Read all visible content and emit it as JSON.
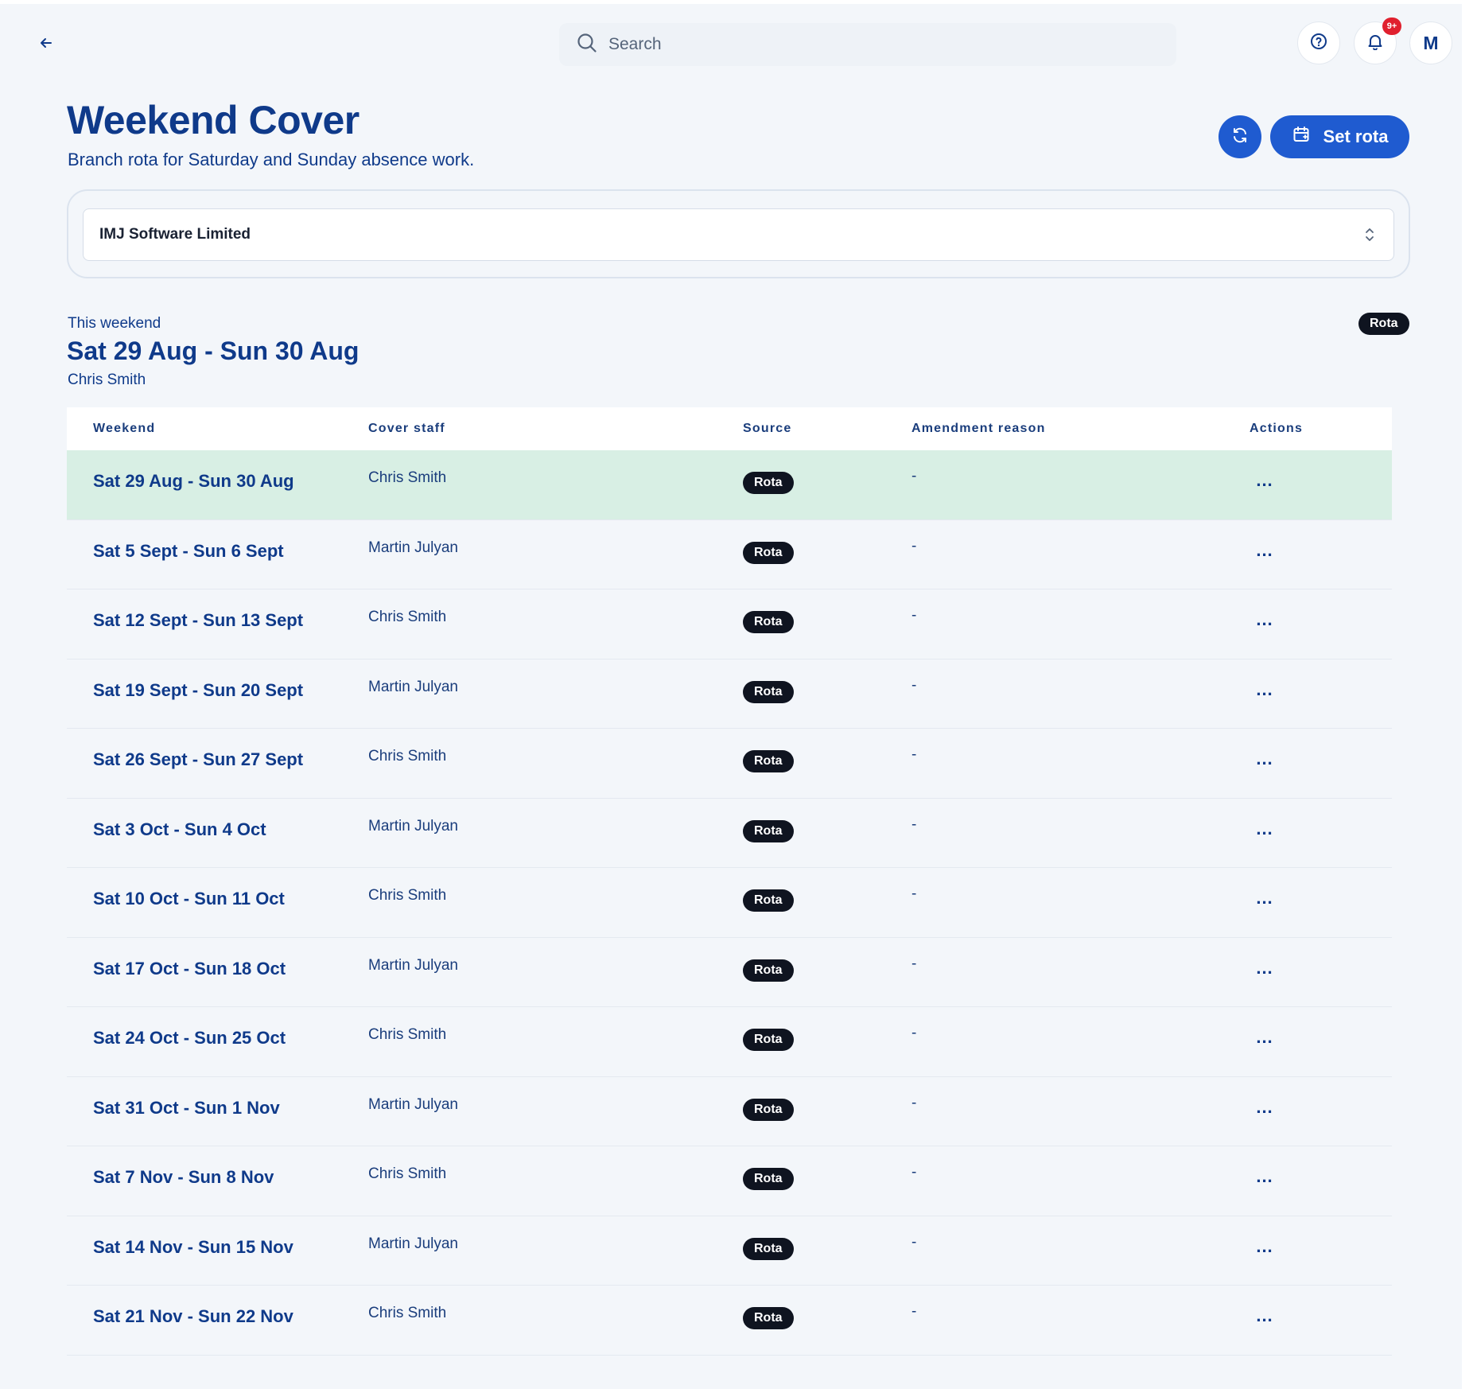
{
  "topbar": {
    "search_placeholder": "Search",
    "notification_count": "9+",
    "avatar_initial": "M"
  },
  "header": {
    "title": "Weekend Cover",
    "subtitle": "Branch rota for Saturday and Sunday absence work.",
    "set_rota_label": "Set rota"
  },
  "branch_select": {
    "value": "IMJ Software Limited"
  },
  "this_weekend": {
    "label": "This weekend",
    "dates": "Sat 29 Aug - Sun 30 Aug",
    "staff": "Chris Smith",
    "source": "Rota"
  },
  "table": {
    "columns": [
      "Weekend",
      "Cover staff",
      "Source",
      "Amendment reason",
      "Actions"
    ],
    "rows": [
      {
        "weekend": "Sat 29 Aug - Sun 30 Aug",
        "staff": "Chris Smith",
        "source": "Rota",
        "reason": "-",
        "actions": "...",
        "current": true
      },
      {
        "weekend": "Sat 5 Sept - Sun 6 Sept",
        "staff": "Martin Julyan",
        "source": "Rota",
        "reason": "-",
        "actions": "..."
      },
      {
        "weekend": "Sat 12 Sept - Sun 13 Sept",
        "staff": "Chris Smith",
        "source": "Rota",
        "reason": "-",
        "actions": "..."
      },
      {
        "weekend": "Sat 19 Sept - Sun 20 Sept",
        "staff": "Martin Julyan",
        "source": "Rota",
        "reason": "-",
        "actions": "..."
      },
      {
        "weekend": "Sat 26 Sept - Sun 27 Sept",
        "staff": "Chris Smith",
        "source": "Rota",
        "reason": "-",
        "actions": "..."
      },
      {
        "weekend": "Sat 3 Oct - Sun 4 Oct",
        "staff": "Martin Julyan",
        "source": "Rota",
        "reason": "-",
        "actions": "..."
      },
      {
        "weekend": "Sat 10 Oct - Sun 11 Oct",
        "staff": "Chris Smith",
        "source": "Rota",
        "reason": "-",
        "actions": "..."
      },
      {
        "weekend": "Sat 17 Oct - Sun 18 Oct",
        "staff": "Martin Julyan",
        "source": "Rota",
        "reason": "-",
        "actions": "..."
      },
      {
        "weekend": "Sat 24 Oct - Sun 25 Oct",
        "staff": "Chris Smith",
        "source": "Rota",
        "reason": "-",
        "actions": "..."
      },
      {
        "weekend": "Sat 31 Oct - Sun 1 Nov",
        "staff": "Martin Julyan",
        "source": "Rota",
        "reason": "-",
        "actions": "..."
      },
      {
        "weekend": "Sat 7 Nov - Sun 8 Nov",
        "staff": "Chris Smith",
        "source": "Rota",
        "reason": "-",
        "actions": "..."
      },
      {
        "weekend": "Sat 14 Nov - Sun 15 Nov",
        "staff": "Martin Julyan",
        "source": "Rota",
        "reason": "-",
        "actions": "..."
      },
      {
        "weekend": "Sat 21 Nov - Sun 22 Nov",
        "staff": "Chris Smith",
        "source": "Rota",
        "reason": "-",
        "actions": "..."
      }
    ]
  },
  "icons": {
    "back": "arrow-left-icon",
    "search": "search-icon",
    "help": "help-circle-icon",
    "notifications": "bell-icon",
    "refresh": "refresh-icon",
    "calendar": "calendar-icon",
    "chevron": "chevron-up-down-icon"
  },
  "colors": {
    "primary": "#1f5bd0",
    "title": "#0f3a8a",
    "current_row": "#d8efe4",
    "badge": "#e0202e",
    "pill": "#0f1420"
  }
}
